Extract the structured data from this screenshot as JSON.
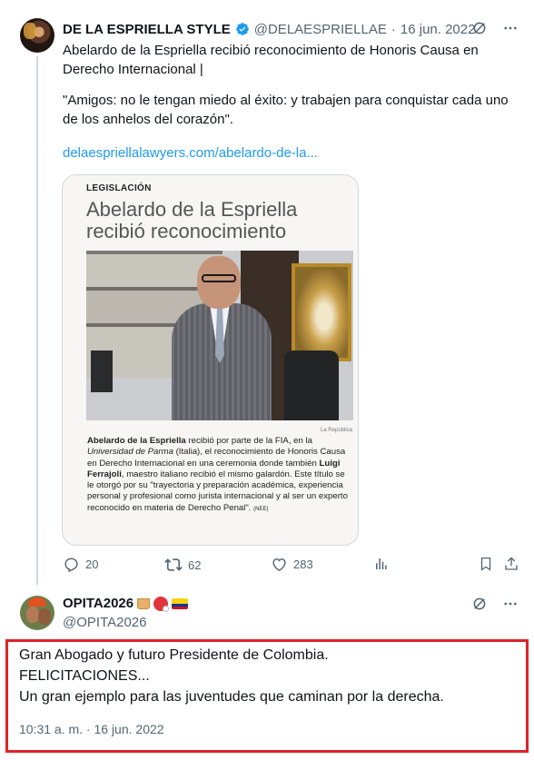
{
  "tweet": {
    "author_name": "DE LA ESPRIELLA STYLE",
    "handle": "@DELAESPRIELLAE",
    "separator": "·",
    "date": "16 jun. 2022",
    "text_line1": "Abelardo de la Espriella recibió reconocimiento de Honoris Causa en Derecho Internacional |",
    "quote": "\"Amigos: no le tengan miedo al éxito: y trabajen para conquistar cada uno de los anhelos del corazón\".",
    "link": "delaespriellalawyers.com/abelardo-de-la...",
    "card": {
      "section": "LEGISLACIÓN",
      "headline": "Abelardo de la Espriella recibió reconocimiento",
      "photo_credit": "La República",
      "article": {
        "p1_bold": "Abelardo de la Espriella",
        "p1_a": " recibió por parte de la FIA, en la ",
        "p1_italic": "Universidad de Parma",
        "p1_b": " (Italia), el reconocimiento de Honoris Causa en Derecho Internacional en una ceremonia donde también ",
        "p2_bold": "Luigi Ferrajoli",
        "p2_a": ", maestro italiano recibió el mismo galardón. Este título se le otorgó por su \"trayectoria y preparación académica, experiencia personal y profesional como jurista internacional y al ser un experto reconocido en materia de Derecho Penal\".",
        "tag": "(NEE)"
      }
    },
    "actions": {
      "replies": "20",
      "retweets": "62",
      "likes": "283"
    },
    "icons": [
      "grok-icon",
      "more-icon",
      "reply-icon",
      "retweet-icon",
      "like-icon",
      "views-icon",
      "bookmark-icon",
      "share-icon",
      "verified-icon"
    ]
  },
  "reply": {
    "author_name": "OPITA2026",
    "handle": "@OPITA2026",
    "line1": "Gran Abogado y futuro Presidente de Colombia.",
    "line2": "FELICITACIONES...",
    "line3": "Un gran ejemplo para las juventudes que caminan por la derecha.",
    "timestamp": "10:31 a. m. · 16 jun. 2022"
  },
  "colors": {
    "accent": "#1d9bf0",
    "muted": "#536471",
    "highlight_border": "#e0222a"
  }
}
